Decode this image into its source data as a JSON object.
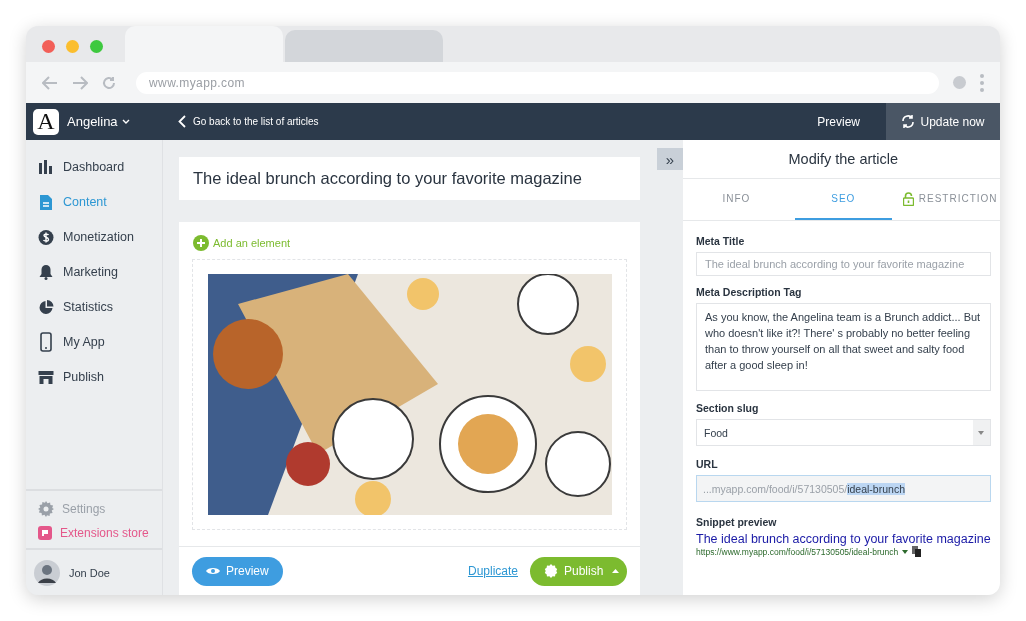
{
  "browser": {
    "tabs": [
      {
        "selected": true
      },
      {
        "selected": false
      }
    ],
    "url": "www.myapp.com"
  },
  "header": {
    "brand_letter": "A",
    "account": "Angelina",
    "back_link": "Go back to the list of articles",
    "preview": "Preview",
    "update": "Update now"
  },
  "sidebar": {
    "items": [
      {
        "label": "Dashboard",
        "kind": "dashboard",
        "selected": false
      },
      {
        "label": "Content",
        "kind": "content",
        "selected": true
      },
      {
        "label": "Monetization",
        "kind": "money",
        "selected": false
      },
      {
        "label": "Marketing",
        "kind": "bell",
        "selected": false
      },
      {
        "label": "Statistics",
        "kind": "pie",
        "selected": false
      },
      {
        "label": "My App",
        "kind": "phone",
        "selected": false
      },
      {
        "label": "Publish",
        "kind": "store",
        "selected": false
      }
    ],
    "footer": [
      {
        "label": "Settings",
        "kind": "settings",
        "disabled": true
      },
      {
        "label": "Extensions store",
        "kind": "extensions",
        "disabled": false
      }
    ],
    "user": "Jon Doe"
  },
  "editor": {
    "collapse": "»",
    "title": "The ideal brunch according to your favorite magazine",
    "add_element": "Add an element",
    "preview": "Preview",
    "duplicate": "Duplicate",
    "publish": "Publish"
  },
  "panel": {
    "title": "Modify the article",
    "tabs": [
      {
        "label": "INFO",
        "selected": false,
        "locked": false
      },
      {
        "label": "SEO",
        "selected": true,
        "locked": false
      },
      {
        "label": "RESTRICTION",
        "selected": false,
        "locked": true
      }
    ],
    "meta_title": {
      "label": "Meta Title",
      "placeholder": "The ideal brunch according to your favorite magazine"
    },
    "meta_description": {
      "label": "Meta Description Tag",
      "value": "As you know, the Angelina team is a Brunch addict... But who doesn't like it?! There' s probably no better feeling than to throw yourself on all that sweet and salty food after a good sleep in!"
    },
    "section_slug": {
      "label": "Section slug",
      "value": "Food"
    },
    "url": {
      "label": "URL",
      "prefix": "...myapp.com/food/i/57130505/",
      "slug": "ideal-brunch",
      "slug_selected": true
    },
    "snippet": {
      "label": "Snippet preview",
      "title": "The ideal brunch according to your favorite magazine",
      "url": "https://www.myapp.com/food/i/57130505/ideal-brunch"
    }
  }
}
